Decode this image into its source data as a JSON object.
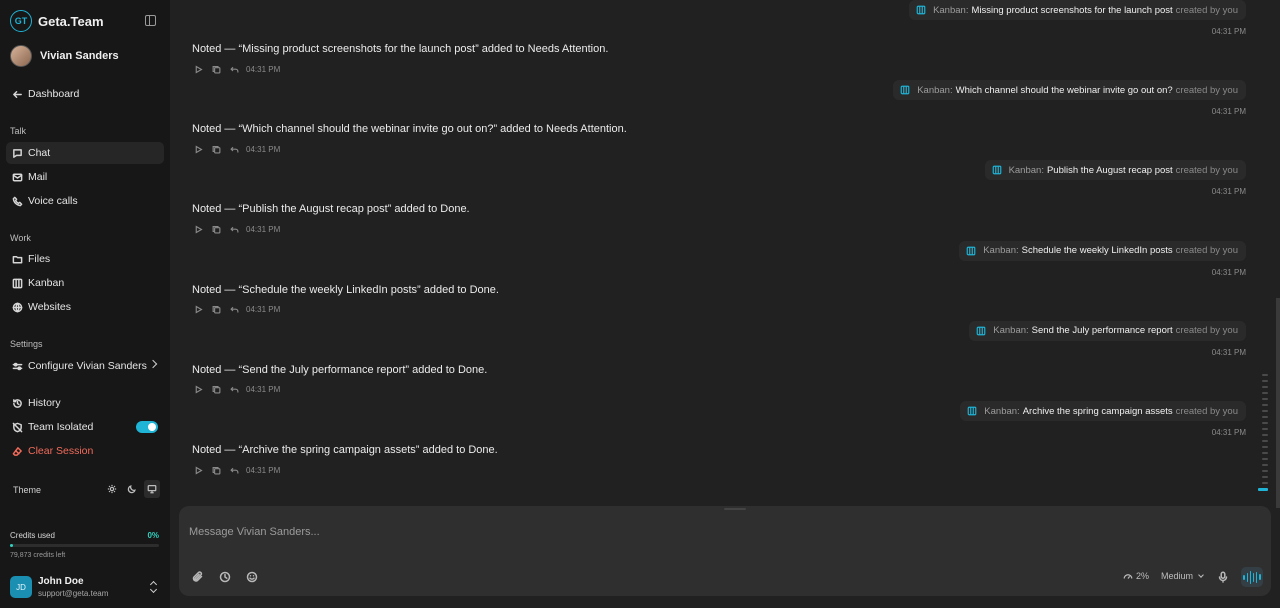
{
  "app": {
    "name": "Geta.Team",
    "logo_initials": "GT"
  },
  "agent": {
    "name": "Vivian Sanders"
  },
  "nav": {
    "dashboard": "Dashboard",
    "talk_label": "Talk",
    "chat": "Chat",
    "mail": "Mail",
    "voice_calls": "Voice calls",
    "work_label": "Work",
    "files": "Files",
    "kanban": "Kanban",
    "websites": "Websites",
    "settings_label": "Settings",
    "configure": "Configure Vivian Sanders",
    "history": "History",
    "team_isolated": "Team Isolated",
    "team_isolated_on": true,
    "clear_session": "Clear Session",
    "theme_label": "Theme",
    "theme_selected": "system"
  },
  "credits": {
    "label": "Credits used",
    "percent": "0%",
    "fraction": 0.02,
    "left": "79,873 credits left"
  },
  "user": {
    "initials": "JD",
    "name": "John Doe",
    "email": "support@geta.team"
  },
  "messages": [
    {
      "kanban": {
        "prefix": "Kanban:",
        "task": "Missing product screenshots for the launch post",
        "suffix": "created by you",
        "time": "04:31 PM"
      },
      "reply": {
        "text": "Noted — “Missing product screenshots for the launch post” added to Needs Attention.",
        "time": "04:31 PM"
      }
    },
    {
      "kanban": {
        "prefix": "Kanban:",
        "task": "Which channel should the webinar invite go out on?",
        "suffix": "created by you",
        "time": "04:31 PM"
      },
      "reply": {
        "text": "Noted — “Which channel should the webinar invite go out on?” added to Needs Attention.",
        "time": "04:31 PM"
      }
    },
    {
      "kanban": {
        "prefix": "Kanban:",
        "task": "Publish the August recap post",
        "suffix": "created by you",
        "time": "04:31 PM"
      },
      "reply": {
        "text": "Noted — “Publish the August recap post” added to Done.",
        "time": "04:31 PM"
      }
    },
    {
      "kanban": {
        "prefix": "Kanban:",
        "task": "Schedule the weekly LinkedIn posts",
        "suffix": "created by you",
        "time": "04:31 PM"
      },
      "reply": {
        "text": "Noted — “Schedule the weekly LinkedIn posts” added to Done.",
        "time": "04:31 PM"
      }
    },
    {
      "kanban": {
        "prefix": "Kanban:",
        "task": "Send the July performance report",
        "suffix": "created by you",
        "time": "04:31 PM"
      },
      "reply": {
        "text": "Noted — “Send the July performance report” added to Done.",
        "time": "04:31 PM"
      }
    },
    {
      "kanban": {
        "prefix": "Kanban:",
        "task": "Archive the spring campaign assets",
        "suffix": "created by you",
        "time": "04:31 PM"
      },
      "reply": {
        "text": "Noted — “Archive the spring campaign assets” added to Done.",
        "time": "04:31 PM"
      }
    }
  ],
  "composer": {
    "placeholder": "Message Vivian Sanders...",
    "context_usage": "2%",
    "model": "Medium"
  },
  "colors": {
    "accent": "#1fb3d6",
    "danger": "#f26b5b",
    "credits": "#2fd3c1"
  },
  "icons": [
    "arrow-left-icon",
    "chat-icon",
    "mail-icon",
    "phone-icon",
    "folder-icon",
    "kanban-icon",
    "globe-icon",
    "sliders-icon",
    "history-icon",
    "shield-off-icon",
    "eraser-icon",
    "sun-icon",
    "moon-icon",
    "monitor-icon",
    "play-icon",
    "copy-icon",
    "reply-icon",
    "paperclip-icon",
    "clock-icon",
    "smile-icon",
    "gauge-icon",
    "mic-icon",
    "waveform-icon"
  ]
}
